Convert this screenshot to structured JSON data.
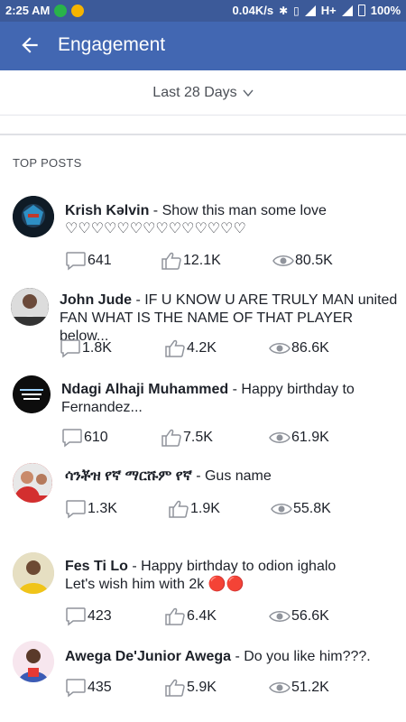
{
  "status_bar": {
    "time": "2:25 AM",
    "net_speed": "0.04K/s",
    "network": "H+",
    "battery": "100%",
    "icons": [
      "whatsapp-icon",
      "notification-icon",
      "bluetooth-icon",
      "vibrate-icon",
      "signal-icon",
      "battery-icon"
    ]
  },
  "header": {
    "title": "Engagement",
    "back_icon": "arrow-left-icon",
    "color": "#4267b2"
  },
  "filter": {
    "label": "Last 28 Days"
  },
  "section": {
    "title": "TOP POSTS"
  },
  "posts": [
    {
      "author": "Krish Kəlvin",
      "text": " - Show this man some love",
      "text2": "♡♡♡♡♡♡♡♡♡♡♡♡♡♡",
      "comments": "641",
      "likes": "12.1K",
      "views": "80.5K"
    },
    {
      "author": "John Jude",
      "text": " - IF U KNOW U ARE TRULY MAN united",
      "text2": "FAN WHAT IS THE NAME OF THAT PLAYER below...",
      "comments": "1.8K",
      "likes": "4.2K",
      "views": "86.6K"
    },
    {
      "author": "Ndagi Alhaji Muhammed",
      "text": " - Happy birthday to",
      "text2": "Fernandez...",
      "comments": "610",
      "likes": "7.5K",
      "views": "61.9K"
    },
    {
      "author": "ሳንቾዝ የኛ ማርሹም የኛ",
      "text": " - Gus name",
      "text2": "",
      "comments": "1.3K",
      "likes": "1.9K",
      "views": "55.8K"
    },
    {
      "author": "Fes Ti Lo",
      "text": " - Happy birthday to odion ighalo",
      "text2": "Let's wish him with 2k 🔴🔴",
      "comments": "423",
      "likes": "6.4K",
      "views": "56.6K"
    },
    {
      "author": "Awega De'Junior Awega",
      "text": " - Do you like him???.",
      "text2": "",
      "comments": "435",
      "likes": "5.9K",
      "views": "51.2K"
    }
  ]
}
